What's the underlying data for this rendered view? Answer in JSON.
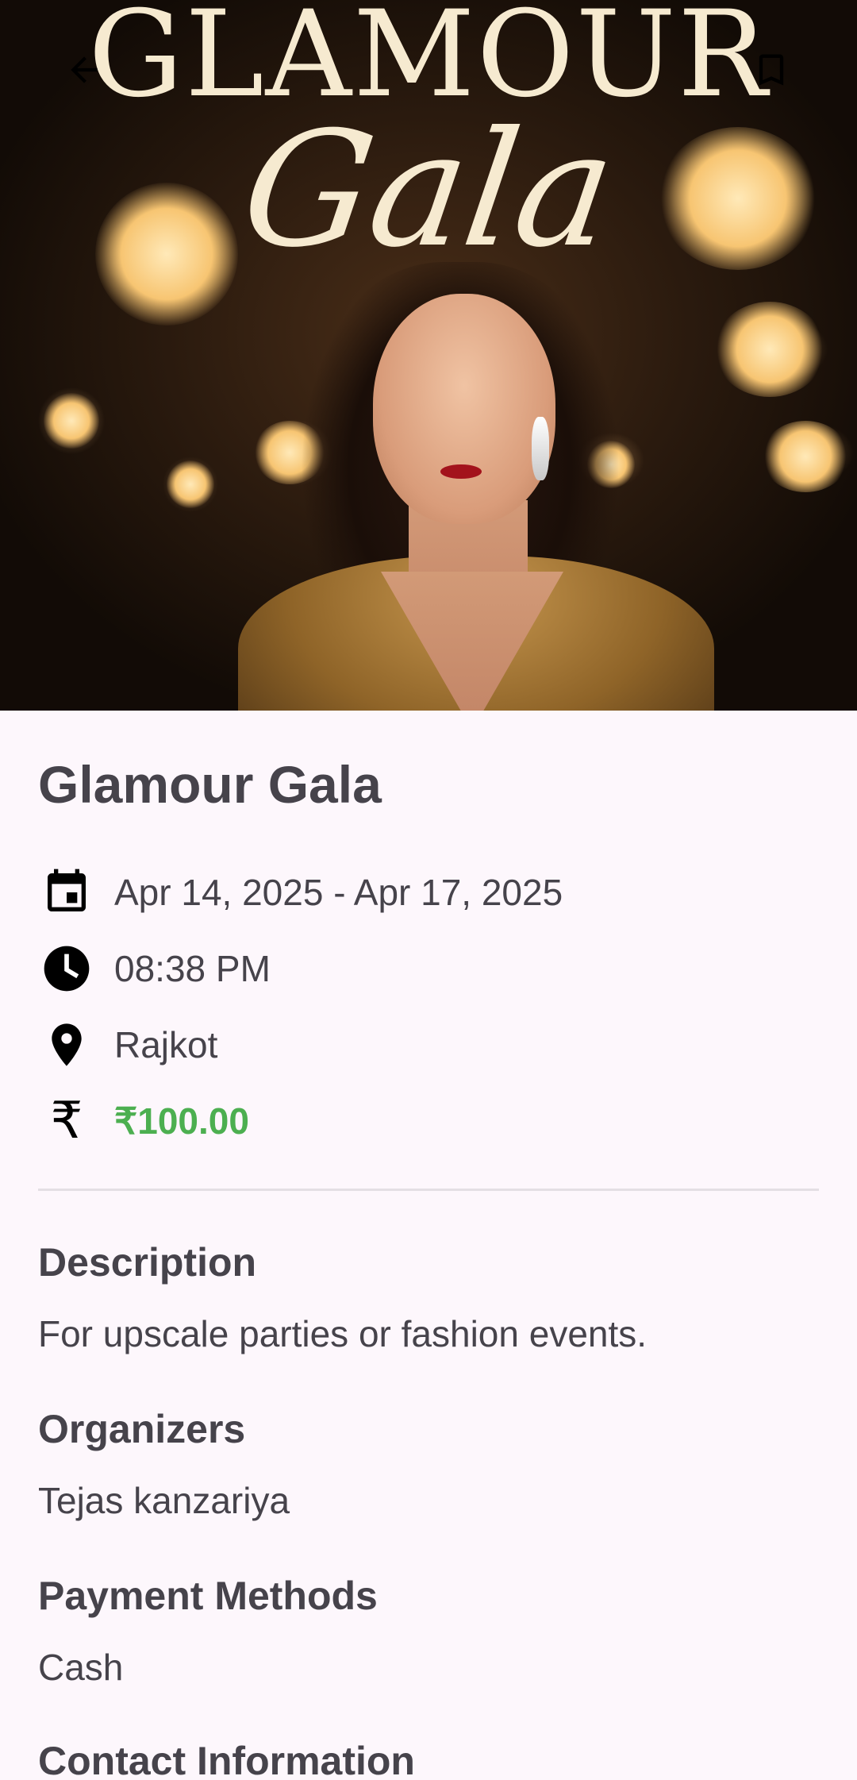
{
  "hero": {
    "poster_title_line1": "GLAMOUR",
    "poster_title_line2": "Gala",
    "back_icon": "arrow-back-icon",
    "bookmark_icon": "bookmark-outline-icon"
  },
  "event": {
    "title": "Glamour Gala",
    "date_range": "Apr 14, 2025 - Apr 17, 2025",
    "time": "08:38 PM",
    "location": "Rajkot",
    "price": "₹100.00",
    "price_icon_glyph": "₹"
  },
  "sections": {
    "description": {
      "heading": "Description",
      "body": "For upscale parties or fashion events."
    },
    "organizers": {
      "heading": "Organizers",
      "body": "Tejas kanzariya"
    },
    "payment": {
      "heading": "Payment Methods",
      "body": "Cash"
    },
    "contact": {
      "heading": "Contact Information"
    }
  },
  "colors": {
    "background": "#fdf7fc",
    "text": "#46434b",
    "price": "#4caf50",
    "poster_text": "#f6ead0"
  }
}
